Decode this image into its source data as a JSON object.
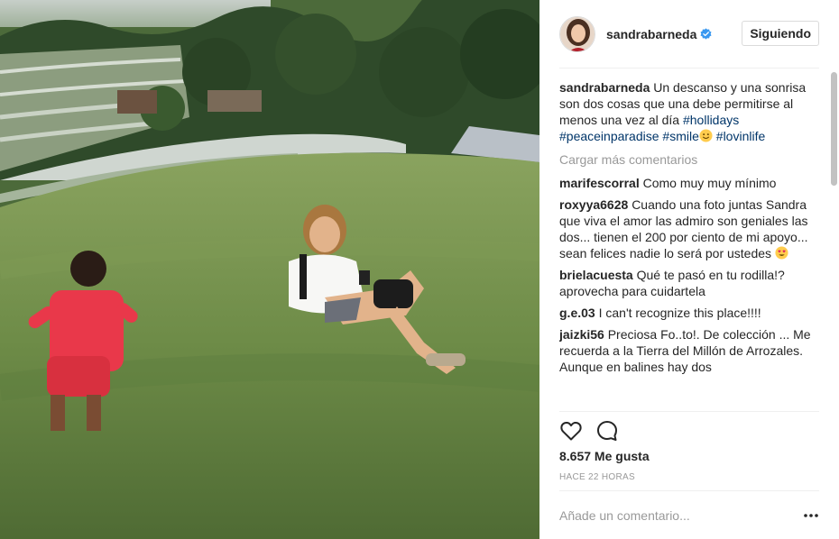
{
  "post": {
    "image_alt": "Mujer sentada en una ladera de hierba junto a un niño con camiseta roja, frente a terrazas de arroz",
    "author": {
      "username": "sandrabarneda",
      "verified": true,
      "follow_label": "Siguiendo"
    },
    "caption": {
      "username": "sandrabarneda",
      "text": "Un descanso y una sonrisa son dos cosas que una debe permitirse al menos una vez al día",
      "hashtags": [
        "#hollidays",
        "#peaceinparadise",
        "#smile",
        "#lovinlife"
      ]
    },
    "load_more_label": "Cargar más comentarios",
    "comments": [
      {
        "username": "marifescorral",
        "text": "Como muy muy mínimo"
      },
      {
        "username": "roxyya6628",
        "text": "Cuando una foto juntas Sandra que viva el amor las admiro son geniales las dos... tienen el 200 por ciento de mi apoyo... sean felices nadie lo será por ustedes"
      },
      {
        "username": "brielacuesta",
        "text": "Qué te pasó en tu rodilla!? aprovecha para cuidartela"
      },
      {
        "username": "g.e.03",
        "text": "I can't recognize this place!!!!"
      },
      {
        "username": "jaizki56",
        "text": "Preciosa Fo..to!. De colección ... Me recuerda a la Tierra del Millón de Arrozales. Aunque en balines hay dos"
      }
    ],
    "likes": "8.657 Me gusta",
    "timestamp": "HACE 22 HORAS",
    "comment_placeholder": "Añade un comentario...",
    "icons": {
      "like": "heart-outline-icon",
      "comment": "speech-bubble-icon",
      "more": "ellipsis-icon",
      "verified": "verified-badge-icon"
    },
    "colors": {
      "text": "#262626",
      "muted": "#999999",
      "hashtag": "#003569",
      "verified": "#3897f0",
      "border": "#dbdbdb"
    }
  }
}
